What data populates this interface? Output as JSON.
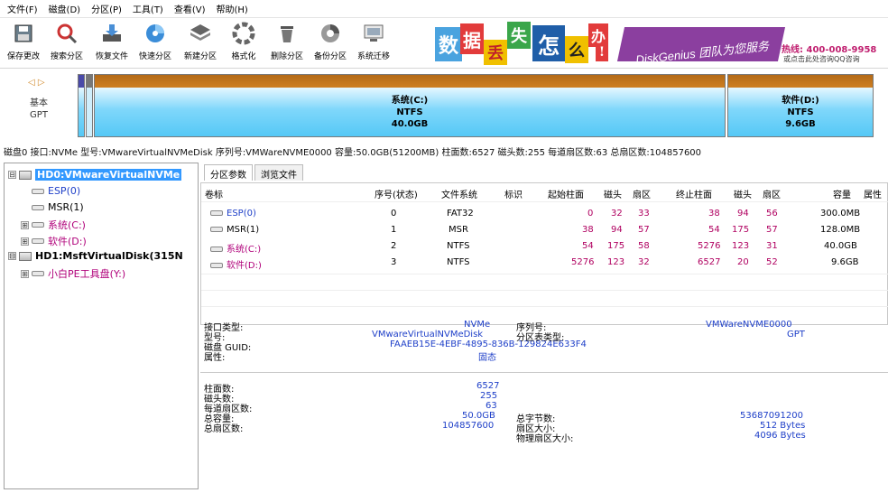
{
  "menu": [
    "文件(F)",
    "磁盘(D)",
    "分区(P)",
    "工具(T)",
    "查看(V)",
    "帮助(H)"
  ],
  "toolbar": [
    {
      "label": "保存更改",
      "icon": "save-icon"
    },
    {
      "label": "搜索分区",
      "icon": "search-icon"
    },
    {
      "label": "恢复文件",
      "icon": "recover-icon"
    },
    {
      "label": "快速分区",
      "icon": "quick-partition-icon"
    },
    {
      "label": "新建分区",
      "icon": "new-partition-icon"
    },
    {
      "label": "格式化",
      "icon": "format-icon"
    },
    {
      "label": "删除分区",
      "icon": "delete-icon"
    },
    {
      "label": "备份分区",
      "icon": "backup-icon"
    },
    {
      "label": "系统迁移",
      "icon": "migrate-icon"
    }
  ],
  "banner": {
    "chars": [
      "数",
      "据",
      "丢",
      "失",
      "怎",
      "么",
      "办",
      "!"
    ],
    "strip": "DiskGenius 团队为您服务",
    "strip_top": "团队为您服务",
    "phone": "热线: 400-008-9958",
    "qq": "或点击此处咨询QQ咨询"
  },
  "diskmap": {
    "nav": "◁ ▷",
    "type_line1": "基本",
    "type_line2": "GPT",
    "partitions": [
      {
        "name": "系统(C:)",
        "fs": "NTFS",
        "size": "40.0GB"
      },
      {
        "name": "软件(D:)",
        "fs": "NTFS",
        "size": "9.6GB"
      }
    ]
  },
  "disk_info": "磁盘0 接口:NVMe  型号:VMwareVirtualNVMeDisk  序列号:VMWareNVME0000  容量:50.0GB(51200MB)  柱面数:6527  磁头数:255  每道扇区数:63  总扇区数:104857600",
  "tree": [
    {
      "label": "HD0:VMwareVirtualNVMe",
      "level": 0,
      "type": "disk",
      "expander": "⊟",
      "selected": true
    },
    {
      "label": "ESP(0)",
      "level": 1,
      "type": "part",
      "color": "blue"
    },
    {
      "label": "MSR(1)",
      "level": 1,
      "type": "part",
      "color": "black"
    },
    {
      "label": "系统(C:)",
      "level": 1,
      "type": "part",
      "color": "purple",
      "expander": "⊞"
    },
    {
      "label": "软件(D:)",
      "level": 1,
      "type": "part",
      "color": "purple",
      "expander": "⊞"
    },
    {
      "label": "HD1:MsftVirtualDisk(315N",
      "level": 0,
      "type": "disk",
      "expander": "⊟"
    },
    {
      "label": "小白PE工具盘(Y:)",
      "level": 1,
      "type": "part",
      "color": "purple",
      "expander": "⊞"
    }
  ],
  "tabs": [
    "分区参数",
    "浏览文件"
  ],
  "table": {
    "headers": [
      "卷标",
      "序号(状态)",
      "文件系统",
      "标识",
      "起始柱面",
      "磁头",
      "扇区",
      "终止柱面",
      "磁头",
      "扇区",
      "容量",
      "属性"
    ],
    "rows": [
      {
        "label": "ESP(0)",
        "seq": "0",
        "fs": "FAT32",
        "id": "",
        "start_cyl": "0",
        "start_head": "32",
        "start_sec": "33",
        "end_cyl": "38",
        "end_head": "94",
        "end_sec": "56",
        "capacity": "300.0MB",
        "attr": "",
        "color": "blue"
      },
      {
        "label": "MSR(1)",
        "seq": "1",
        "fs": "MSR",
        "id": "",
        "start_cyl": "38",
        "start_head": "94",
        "start_sec": "57",
        "end_cyl": "54",
        "end_head": "175",
        "end_sec": "57",
        "capacity": "128.0MB",
        "attr": "",
        "color": "black"
      },
      {
        "label": "系统(C:)",
        "seq": "2",
        "fs": "NTFS",
        "id": "",
        "start_cyl": "54",
        "start_head": "175",
        "start_sec": "58",
        "end_cyl": "5276",
        "end_head": "123",
        "end_sec": "31",
        "capacity": "40.0GB",
        "attr": "",
        "color": "purple"
      },
      {
        "label": "软件(D:)",
        "seq": "3",
        "fs": "NTFS",
        "id": "",
        "start_cyl": "5276",
        "start_head": "123",
        "start_sec": "32",
        "end_cyl": "6527",
        "end_head": "20",
        "end_sec": "52",
        "capacity": "9.6GB",
        "attr": "",
        "color": "purple"
      }
    ]
  },
  "info": {
    "iface_label": "接口类型:",
    "iface_value": "NVMe",
    "model_label": "型号:",
    "model_value": "VMwareVirtualNVMeDisk",
    "guid_label": "磁盘 GUID:",
    "guid_value": "FAAEB15E-4EBF-4895-836B-129824E633F4",
    "attr_label": "属性:",
    "attr_value": "固态",
    "serial_label": "序列号:",
    "serial_value": "VMWareNVME0000",
    "pt_label": "分区表类型:",
    "pt_value": "GPT",
    "cyl_label": "柱面数:",
    "cyl_value": "6527",
    "head_label": "磁头数:",
    "head_value": "255",
    "spt_label": "每道扇区数:",
    "spt_value": "63",
    "cap_label": "总容量:",
    "cap_value": "50.0GB",
    "tsec_label": "总扇区数:",
    "tsec_value": "104857600",
    "bytes_label": "总字节数:",
    "bytes_value": "53687091200",
    "secsize_label": "扇区大小:",
    "secsize_value": "512 Bytes",
    "physsec_label": "物理扇区大小:",
    "physsec_value": "4096 Bytes"
  },
  "colors": {
    "blue": "#1e3fc8",
    "purple": "#b0007a",
    "selected": "#3399ff"
  }
}
